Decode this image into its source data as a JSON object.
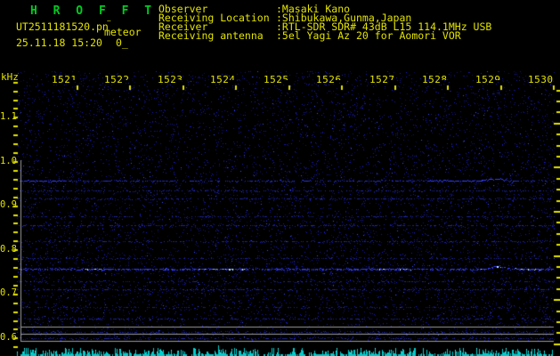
{
  "app": {
    "title": "H R O F F T"
  },
  "header": {
    "filename": "UT2511181520.pn",
    "filename_artifact": "¨",
    "mode_label": "meteor",
    "datetime": "25.11.18 15:20",
    "counter": "0_",
    "fields": [
      {
        "label": "Observer",
        "value": ":Masaki Kano"
      },
      {
        "label": "Receiving Location",
        "value": ":Shibukawa,Gunma,Japan"
      },
      {
        "label": "Receiver",
        "value": ":RTL-SDR SDR# 43dB L15 114.1MHz USB"
      },
      {
        "label": "Receiving antenna",
        "value": ":5el Yagi Az 20 for Aomori VOR"
      }
    ]
  },
  "axes": {
    "y_unit": "kHz",
    "y_labels": [
      "1.1",
      "1.0",
      "0.9",
      "0.8",
      "0.7",
      "0.6"
    ],
    "x_labels": [
      "1521",
      "1522",
      "1523",
      "1524",
      "1525",
      "1526",
      "1527",
      "1528",
      "1529",
      "1530"
    ]
  },
  "chart_data": {
    "type": "heatmap",
    "subtype": "radio-meteor-spectrogram",
    "x_axis": {
      "unit": "UT hhmm",
      "range": [
        1520,
        1530
      ],
      "ticks": [
        "1521",
        "1522",
        "1523",
        "1524",
        "1525",
        "1526",
        "1527",
        "1528",
        "1529",
        "1530"
      ]
    },
    "y_axis": {
      "unit": "kHz",
      "ticks": [
        1.1,
        1.0,
        0.9,
        0.8,
        0.7,
        0.6
      ],
      "range_khz": [
        0.58,
        1.17
      ]
    },
    "noise_density": 0.045,
    "signal_lines_khz": [
      {
        "freq": 0.955,
        "strength": 0.55,
        "bright_spans": [
          [
            1520.0,
            1520.75
          ],
          [
            1527.6,
            1529.1
          ]
        ],
        "bump": [
          1528.6,
          1529.2,
          -2
        ]
      },
      {
        "freq": 0.933,
        "strength": 0.3
      },
      {
        "freq": 0.915,
        "strength": 0.25
      },
      {
        "freq": 0.875,
        "strength": 0.18
      },
      {
        "freq": 0.855,
        "strength": 0.3
      },
      {
        "freq": 0.817,
        "strength": 0.25
      },
      {
        "freq": 0.78,
        "strength": 0.15
      },
      {
        "freq": 0.755,
        "strength": 0.85,
        "bright_spans": [
          [
            1521.0,
            1521.6
          ],
          [
            1523.3,
            1524.2
          ],
          [
            1526.6,
            1527.3
          ],
          [
            1528.6,
            1529.75
          ]
        ],
        "bump": [
          1528.7,
          1529.2,
          -3
        ]
      },
      {
        "freq": 0.728,
        "strength": 0.2
      },
      {
        "freq": 0.708,
        "strength": 0.25
      },
      {
        "freq": 0.668,
        "strength": 0.12
      },
      {
        "freq": 0.643,
        "strength": 0.25
      },
      {
        "freq": 0.613,
        "strength": 0.3
      },
      {
        "freq": 0.598,
        "strength": 0.25
      }
    ],
    "bottom_level_plot": {
      "description": "received RF level, random spikes",
      "color": "#00cdcd"
    }
  },
  "colors": {
    "background": "#000000",
    "title_green": "#00cc22",
    "text_yellow": "#e3e300",
    "frame_gray": "#9a9a9a",
    "noise_blue": "#2222cc",
    "signal_blue": "#3c5aff",
    "level_cyan": "#00cdcd"
  }
}
